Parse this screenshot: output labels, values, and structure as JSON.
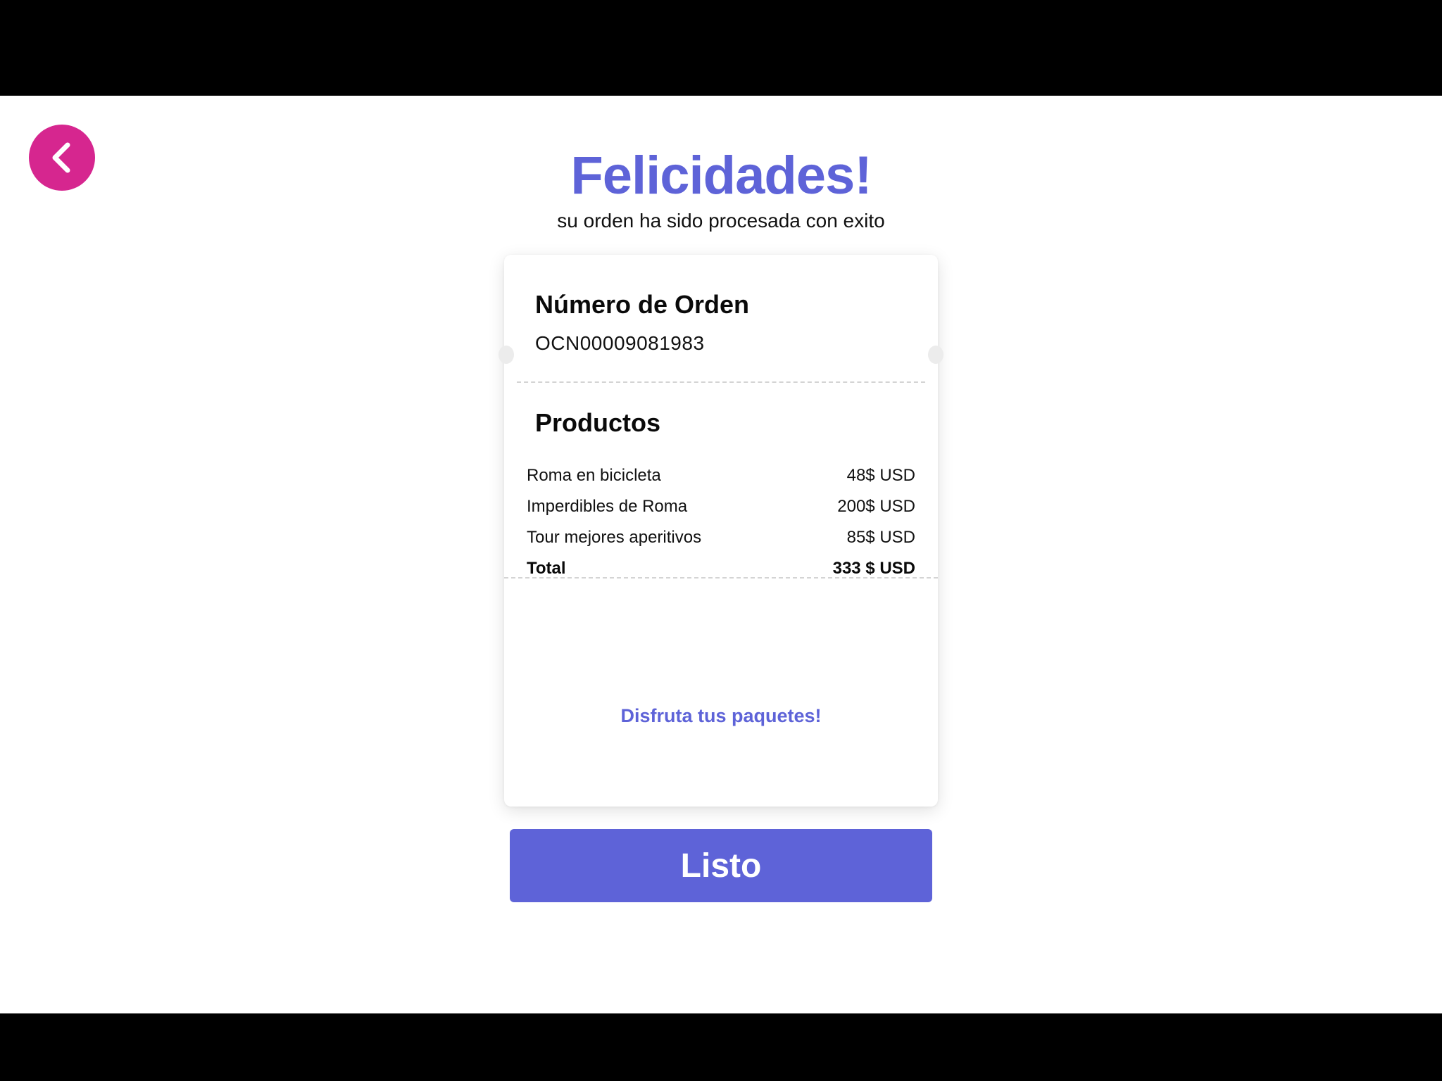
{
  "header": {
    "back_icon": "chevron-left-icon",
    "title": "Felicidades!",
    "subtitle": "su orden ha sido procesada con exito"
  },
  "receipt": {
    "order_heading": "Número de Orden",
    "order_number": "OCN00009081983",
    "products_heading": "Productos",
    "items": [
      {
        "name": "Roma en bicicleta",
        "price": "48$ USD"
      },
      {
        "name": "Imperdibles de Roma",
        "price": "200$ USD"
      },
      {
        "name": "Tour mejores aperitivos",
        "price": "85$ USD"
      }
    ],
    "total_label": "Total",
    "total_value": "333 $ USD",
    "enjoy_message": "Disfruta tus paquetes!"
  },
  "actions": {
    "done_label": "Listo"
  },
  "colors": {
    "accent": "#5e63d8",
    "back_button": "#d6268f",
    "background": "#ffffff"
  }
}
